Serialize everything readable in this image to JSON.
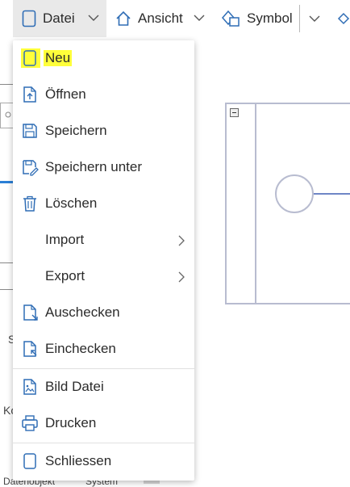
{
  "toolbar": {
    "file_label": "Datei",
    "view_label": "Ansicht",
    "symbol_label": "Symbol"
  },
  "menu": {
    "items": [
      {
        "label": "Neu",
        "icon": "new-file-icon"
      },
      {
        "label": "Öffnen",
        "icon": "open-file-icon"
      },
      {
        "label": "Speichern",
        "icon": "save-icon"
      },
      {
        "label": "Speichern unter",
        "icon": "save-as-icon"
      },
      {
        "label": "Löschen",
        "icon": "trash-icon"
      },
      {
        "label": "Import",
        "icon": "",
        "submenu": true
      },
      {
        "label": "Export",
        "icon": "",
        "submenu": true
      },
      {
        "label": "Auschecken",
        "icon": "checkout-icon"
      },
      {
        "label": "Einchecken",
        "icon": "checkin-icon"
      },
      {
        "label": "Bild Datei",
        "icon": "image-file-icon"
      },
      {
        "label": "Drucken",
        "icon": "print-icon"
      },
      {
        "label": "Schliessen",
        "icon": "close-file-icon"
      }
    ]
  },
  "background": {
    "frag_s": "S",
    "frag_ko": "Ko",
    "bottom_left": "Datenobjekt",
    "bottom_right": "System"
  },
  "colors": {
    "accent": "#2b6cb0",
    "icon_blue": "#2f6db5",
    "highlight": "#ffff3a",
    "menu_border": "#e1e1e1",
    "canvas_line": "#b8bcd0"
  }
}
